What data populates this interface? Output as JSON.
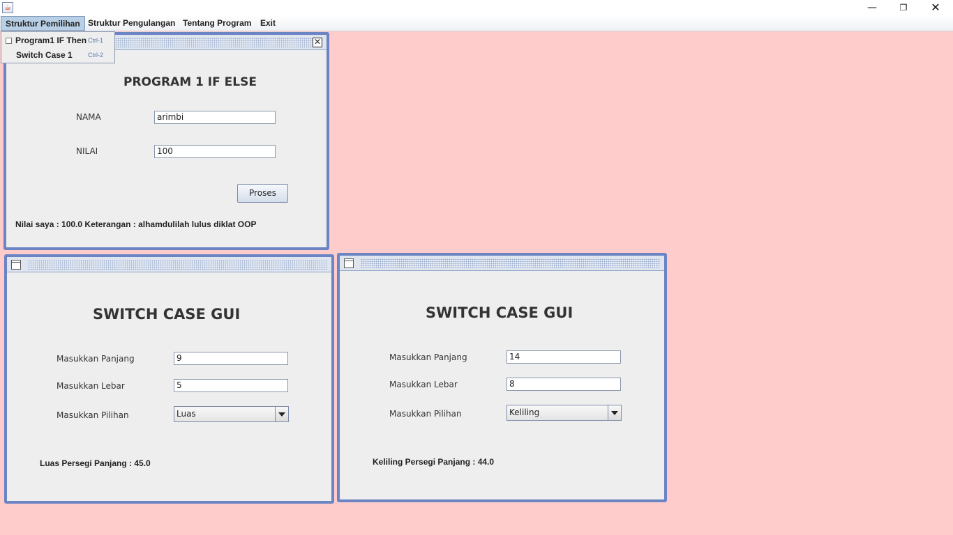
{
  "window": {
    "icon": "java-icon",
    "minimize": "—",
    "maximize": "❐",
    "close": "✕"
  },
  "menu": {
    "items": [
      {
        "label": "Struktur Pemilihan"
      },
      {
        "label": "Struktur Pengulangan"
      },
      {
        "label": "Tentang Program"
      },
      {
        "label": "Exit"
      }
    ],
    "dropdown": [
      {
        "label": "Program1 IF Then",
        "accelerator": "Ctrl-1"
      },
      {
        "label": "Switch Case 1",
        "accelerator": "Ctrl-2"
      }
    ]
  },
  "frame_if": {
    "close_glyph": "✕",
    "title": "PROGRAM 1 IF ELSE",
    "nama_label": "NAMA",
    "nama_value": "arimbi",
    "nilai_label": "NILAI",
    "nilai_value": "100",
    "button_label": "Proses",
    "result": "Nilai saya : 100.0 Keterangan : alhamdulilah lulus diklat OOP"
  },
  "frame_switch1": {
    "title": "SWITCH CASE GUI",
    "panjang_label": "Masukkan Panjang",
    "panjang_value": "9",
    "lebar_label": "Masukkan Lebar",
    "lebar_value": "5",
    "pilihan_label": "Masukkan Pilihan",
    "pilihan_value": "Luas",
    "result": "Luas Persegi Panjang : 45.0"
  },
  "frame_switch2": {
    "title": "SWITCH CASE GUI",
    "panjang_label": "Masukkan Panjang",
    "panjang_value": "14",
    "lebar_label": "Masukkan Lebar",
    "lebar_value": "8",
    "pilihan_label": "Masukkan Pilihan",
    "pilihan_value": "Keliling",
    "result": "Keliling Persegi Panjang : 44.0"
  },
  "colors": {
    "desktop": "#ffcccc",
    "frame_border": "#6a84c4",
    "panel": "#eeeeee",
    "menu_active": "#b8cfe5"
  }
}
